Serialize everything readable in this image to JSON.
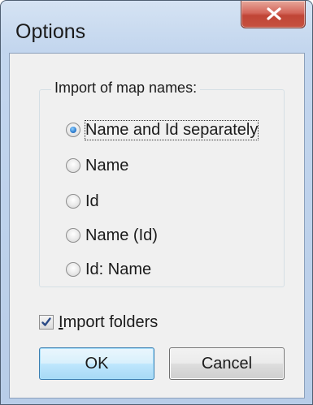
{
  "window": {
    "title": "Options"
  },
  "group": {
    "legend": "Import of map names:",
    "options": [
      {
        "label": "Name and Id separately",
        "checked": true
      },
      {
        "label": "Name",
        "checked": false
      },
      {
        "label": "Id",
        "checked": false
      },
      {
        "label": "Name (Id)",
        "checked": false
      },
      {
        "label": "Id: Name",
        "checked": false
      }
    ]
  },
  "import_folders": {
    "accel": "I",
    "rest": "mport folders",
    "checked": true
  },
  "buttons": {
    "ok": "OK",
    "cancel": "Cancel"
  },
  "colors": {
    "close_button": "#c6513f",
    "default_button": "#a7d9f5",
    "frame": "#c3d6ee"
  }
}
